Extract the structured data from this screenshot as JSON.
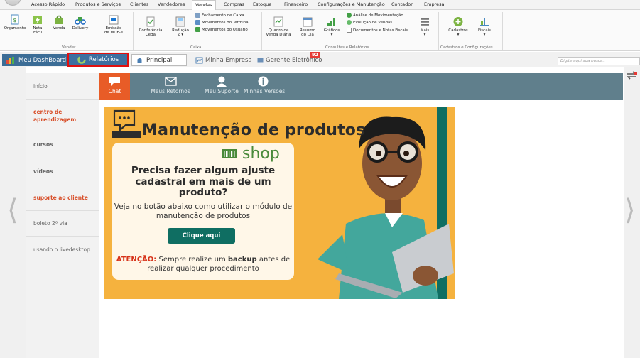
{
  "menu": [
    "Acesso Rápido",
    "Produtos e Serviços",
    "Clientes",
    "Vendedores",
    "Vendas",
    "Compras",
    "Estoque",
    "Financeiro",
    "Configurações e Manutenção",
    "Contador",
    "Empresa"
  ],
  "menu_active_index": 4,
  "ribbon": {
    "orcamento": "Orçamento",
    "nota1": "Nota",
    "nota2": "Fácil",
    "venda": "Venda",
    "delivery": "Delivery",
    "emissao1": "Emissão",
    "emissao2": "de MDF-e",
    "group_vender": "Vender",
    "conf1": "Conferência",
    "conf2": "Cega",
    "red1": "Redução",
    "red2": "Z ▾",
    "fech": "Fechamento de Caixa",
    "movterm": "Movimentos do Terminal",
    "movusr": "Movimentos do Usuário",
    "group_caixa": "Caixa",
    "quadro1": "Quadro de",
    "quadro2": "Venda Diária",
    "resumo1": "Resumo",
    "resumo2": "do Dia",
    "graficos1": "Gráficos",
    "graficos2": "▾",
    "analise": "Análise de Movimentação",
    "evolucao": "Evolução de Vendas",
    "docs": "Documentos e Notas Fiscais",
    "mais1": "Mais",
    "mais2": "▾",
    "group_consultas": "Consultas e Relatórios",
    "cad1": "Cadastros",
    "cad2": "▾",
    "fisc1": "Fiscais",
    "fisc2": "▾",
    "group_cadastros": "Cadastros e Configurações"
  },
  "tabs": {
    "dashboard": "Meu DashBoard",
    "relatorios": "Relatórios",
    "principal": "Principal",
    "empresa": "Minha Empresa",
    "gerente": "Gerente Eletrônico",
    "gerente_badge": "92"
  },
  "search_placeholder": "Digite aqui sua busca..",
  "sidebar": [
    {
      "label": "início"
    },
    {
      "label": "centro de aprendizagem"
    },
    {
      "label": "cursos"
    },
    {
      "label": "vídeos"
    },
    {
      "label": "suporte ao cliente"
    },
    {
      "label": "boleto 2º via"
    },
    {
      "label": "usando o livedesktop"
    }
  ],
  "toptabs": {
    "chat": "Chat",
    "retornos": "Meus Retornos",
    "suporte": "Meu Suporte",
    "versoes": "Minhas Versões"
  },
  "banner": {
    "title": "Manutenção de produtos",
    "shop": "shop",
    "heading": "Precisa fazer algum ajuste cadastral em mais de um produto?",
    "text": "Veja no botão abaixo como utilizar o módulo de manutenção de produtos",
    "button": "Clique aqui",
    "warn_label": "ATENÇÃO:",
    "warn_a": "Sempre realize um",
    "warn_b": "backup",
    "warn_c": "antes de realizar qualquer procedimento"
  },
  "colors": {
    "accent": "#e85c27",
    "strip": "#607f8c",
    "banner": "#f5b23e",
    "button": "#0f6e62"
  }
}
